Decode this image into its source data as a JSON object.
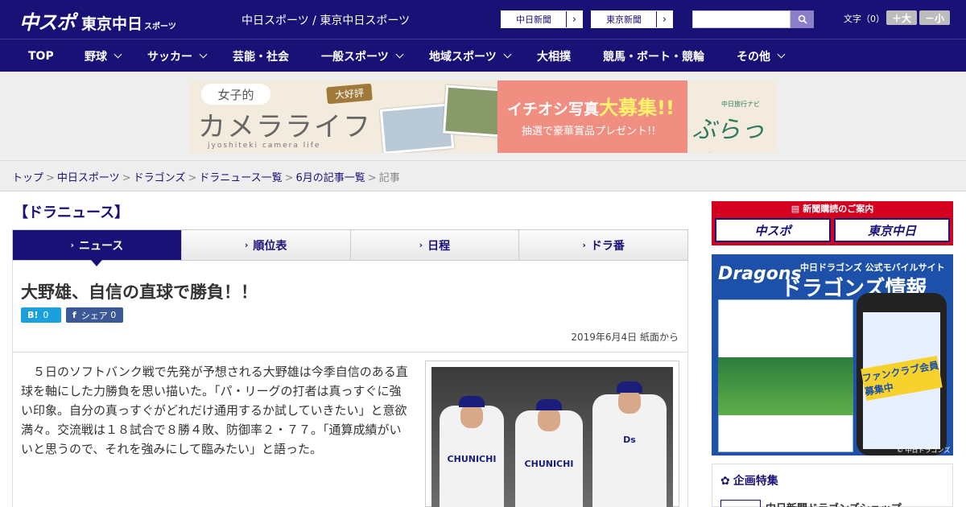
{
  "header": {
    "logo_main": "中スポ",
    "logo_sub": "東京中日",
    "logo_sub_small": "スポーツ",
    "site_name": "中日スポーツ / 東京中日スポーツ",
    "ext_links": [
      {
        "label": "中日新聞"
      },
      {
        "label": "東京新聞"
      }
    ],
    "search_placeholder": "",
    "font_size_label": "文字（0）",
    "font_larger": "＋大",
    "font_smaller": "－小"
  },
  "nav": {
    "items": [
      {
        "label": "TOP",
        "has_menu": false
      },
      {
        "label": "野球",
        "has_menu": true
      },
      {
        "label": "サッカー",
        "has_menu": true
      },
      {
        "label": "芸能・社会",
        "has_menu": false
      },
      {
        "label": "一般スポーツ",
        "has_menu": true
      },
      {
        "label": "地域スポーツ",
        "has_menu": true
      },
      {
        "label": "大相撲",
        "has_menu": false
      },
      {
        "label": "競馬・ボート・競輪",
        "has_menu": false
      },
      {
        "label": "その他",
        "has_menu": true
      }
    ]
  },
  "banner": {
    "bubble": "女子的",
    "title": "カメラライフ",
    "tag": "大好評",
    "sub": "jyoshiteki camera life",
    "pink_title_a": "イチオシ写真",
    "pink_title_b": "大募集!!",
    "pink_sub": "抽選で豪華賞品プレゼント!!",
    "logo_small": "中日旅行ナビ",
    "logo": "ぶらっ人"
  },
  "breadcrumb": {
    "links": [
      "トップ",
      "中日スポーツ",
      "ドラゴンズ",
      "ドラニュース一覧",
      "6月の記事一覧"
    ],
    "current": "記事"
  },
  "section_title": "【ドラニュース】",
  "tabs": [
    {
      "label": "ニュース",
      "active": true
    },
    {
      "label": "順位表",
      "active": false
    },
    {
      "label": "日程",
      "active": false
    },
    {
      "label": "ドラ番",
      "active": false
    }
  ],
  "article": {
    "headline": "大野雄、自信の直球で勝負！！",
    "hatena_label": "B!",
    "hatena_count": "0",
    "fb_label": "シェア",
    "fb_count": "0",
    "date": "2019年6月4日 紙面から",
    "body": "　５日のソフトバンク戦で先発が予想される大野雄は今季自信のある直球を軸にした力勝負を思い描いた。「パ・リーグの打者は真っすぐに強い印象。自分の真っすぐがどれだけ通用するか試していきたい」と意欲満々。交流戦は１８試合で８勝４敗、防御率２・７７。「通算成績がいいと思うので、それを強みにして臨みたい」と語った。",
    "photo_jersey_1": "CHUNICHI",
    "photo_jersey_2": "CHUNICHI",
    "photo_jersey_3": "Ds"
  },
  "sidebar": {
    "subscribe_header": "新聞購読のご案内",
    "subscribe_a": "中スポ",
    "subscribe_b": "東京中日",
    "app_brand": "Dragons",
    "app_line1": "中日ドラゴンズ 公式モバイルサイト",
    "app_line2": "ドラゴンズ情報",
    "app_badge": "ファンクラブ会員募集中",
    "app_copy": "© 中日ドラゴンズ",
    "feature_title": "企画特集",
    "feature_item": "中日新聞ドラゴンズショップ"
  },
  "colors": {
    "brand_navy": "#1a1177",
    "hatena": "#1aa0dc",
    "facebook": "#3b5998",
    "subscribe_red": "#d4001f"
  }
}
